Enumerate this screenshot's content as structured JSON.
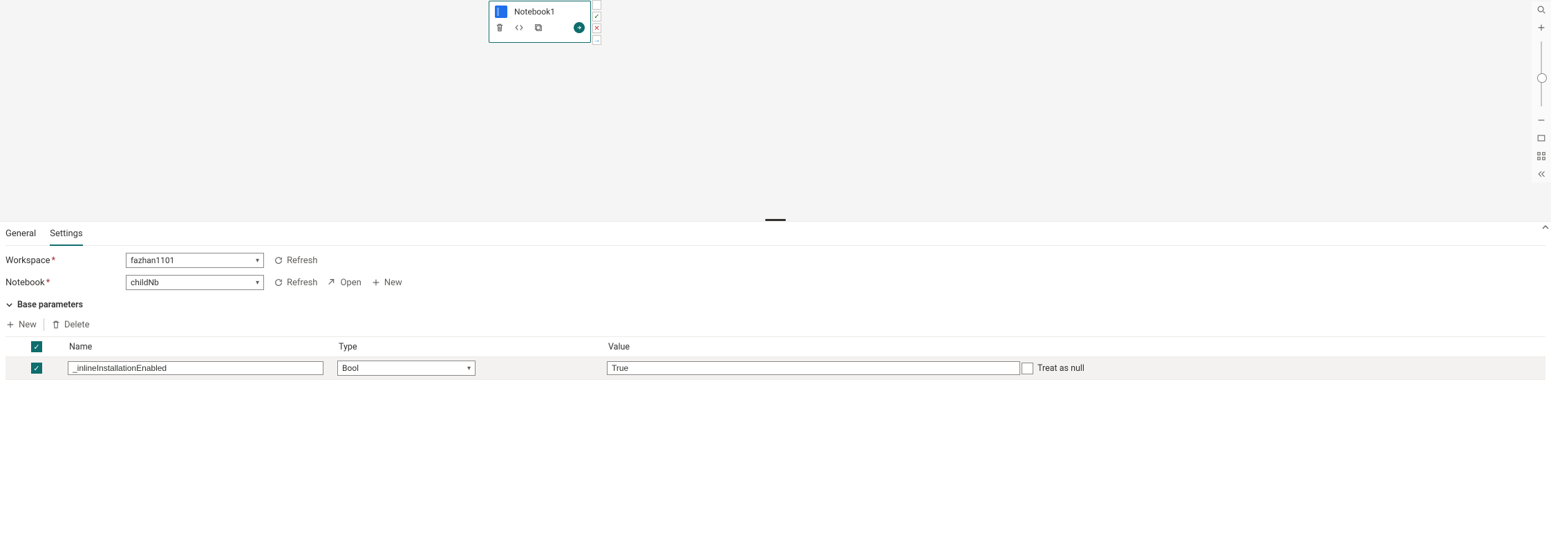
{
  "canvas": {
    "activity": {
      "title": "Notebook1",
      "status_markers": [
        "✓",
        "✕",
        "→"
      ]
    }
  },
  "tool_rail": {
    "search": "search",
    "zoom_in": "plus",
    "zoom_out": "minus",
    "fit": "fit",
    "align": "align",
    "collapse": "collapse"
  },
  "panel": {
    "tabs": {
      "general": "General",
      "settings": "Settings",
      "active": "settings"
    },
    "workspace": {
      "label": "Workspace",
      "required": true,
      "value": "fazhan1101",
      "refresh": "Refresh"
    },
    "notebook": {
      "label": "Notebook",
      "required": true,
      "value": "childNb",
      "refresh": "Refresh",
      "open": "Open",
      "new": "New"
    },
    "base_params": {
      "header": "Base parameters",
      "toolbar": {
        "new": "New",
        "delete": "Delete"
      },
      "columns": {
        "name": "Name",
        "type": "Type",
        "value": "Value",
        "treat_null": "Treat as null"
      },
      "rows": [
        {
          "checked": true,
          "name": "_inlineInstallationEnabled",
          "type": "Bool",
          "value": "True",
          "treat_as_null": false
        }
      ]
    }
  }
}
